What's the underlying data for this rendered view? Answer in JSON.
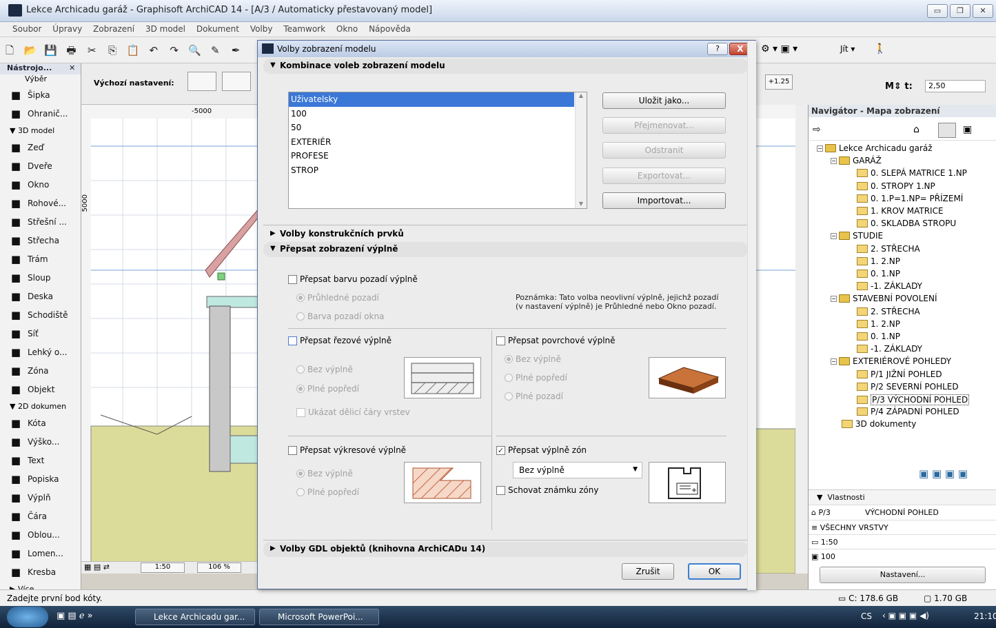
{
  "window": {
    "title": "Lekce Archicadu garáž - Graphisoft ArchiCAD 14 - [A/3 / Automaticky přestavovaný model]"
  },
  "menu": [
    "Soubor",
    "Úpravy",
    "Zobrazení",
    "3D model",
    "Dokument",
    "Volby",
    "Teamwork",
    "Okno",
    "Nápověda"
  ],
  "toolbox": {
    "title": "Nástrojo...",
    "select_label": "Výběr",
    "tools_a": [
      {
        "icon": "arrow-icon",
        "label": "Šipka"
      },
      {
        "icon": "marquee-icon",
        "label": "Ohranič..."
      }
    ],
    "section_3d": "3D model",
    "tools_3d": [
      {
        "icon": "wall-icon",
        "label": "Zeď"
      },
      {
        "icon": "door-icon",
        "label": "Dveře"
      },
      {
        "icon": "window-icon",
        "label": "Okno"
      },
      {
        "icon": "corner-window-icon",
        "label": "Rohové..."
      },
      {
        "icon": "roof-window-icon",
        "label": "Střešní ..."
      },
      {
        "icon": "roof-icon",
        "label": "Střecha"
      },
      {
        "icon": "beam-icon",
        "label": "Trám"
      },
      {
        "icon": "column-icon",
        "label": "Sloup"
      },
      {
        "icon": "slab-icon",
        "label": "Deska"
      },
      {
        "icon": "stair-icon",
        "label": "Schodiště"
      },
      {
        "icon": "mesh-icon",
        "label": "Síť"
      },
      {
        "icon": "curtain-wall-icon",
        "label": "Lehký o..."
      },
      {
        "icon": "zone-icon",
        "label": "Zóna"
      },
      {
        "icon": "object-icon",
        "label": "Objekt"
      }
    ],
    "section_2d": "2D dokumen",
    "tools_2d": [
      {
        "icon": "dimension-icon",
        "label": "Kóta"
      },
      {
        "icon": "level-icon",
        "label": "Výško..."
      },
      {
        "icon": "text-icon",
        "label": "Text"
      },
      {
        "icon": "label-icon",
        "label": "Popiska"
      },
      {
        "icon": "fill-icon",
        "label": "Výplň"
      },
      {
        "icon": "line-icon",
        "label": "Čára"
      },
      {
        "icon": "arc-icon",
        "label": "Oblou..."
      },
      {
        "icon": "polyline-icon",
        "label": "Lomen..."
      },
      {
        "icon": "drawing-icon",
        "label": "Kresba"
      }
    ],
    "more": "Více"
  },
  "infobox": {
    "default_label": "Výchozí nastavení:",
    "scale_btn": "+1.25",
    "value": "2,50"
  },
  "canvas": {
    "ruler": "-5000",
    "vruler": "5000",
    "scale": "1:50",
    "zoom": "106 %"
  },
  "status": {
    "prompt": "Zadejte první bod kóty.",
    "disk": "C: 178.6 GB",
    "ram": "1.70 GB"
  },
  "taskbar": {
    "tasks": [
      "Lekce Archicadu gar...",
      "Microsoft PowerPoi..."
    ],
    "lang": "CS",
    "time": "21:10"
  },
  "navigator": {
    "title": "Navigátor - Mapa zobrazení",
    "project": "Lekce Archicadu garáž",
    "groups": [
      {
        "name": "GARÁŽ",
        "items": [
          "0. SLEPÁ MATRICE 1.NP",
          "0. STROPY 1.NP",
          "0. 1.P=1.NP= PŘÍZEMÍ",
          "1. KROV MATRICE",
          "0. SKLADBA STROPU"
        ]
      },
      {
        "name": "STUDIE",
        "items": [
          "2. STŘECHA",
          "1. 2.NP",
          "0. 1.NP",
          "-1. ZÁKLADY"
        ]
      },
      {
        "name": "STAVEBNÍ POVOLENÍ",
        "items": [
          "2. STŘECHA",
          "1. 2.NP",
          "0. 1.NP",
          "-1. ZÁKLADY"
        ]
      },
      {
        "name": "EXTERIÉROVÉ POHLEDY",
        "items": [
          "P/1 JIŽNÍ POHLED",
          "P/2 SEVERNÍ POHLED",
          "P/3 VÝCHODNÍ POHLED",
          "P/4 ZÁPADNÍ POHLED"
        ]
      }
    ],
    "docs": "3D dokumenty",
    "props_title": "Vlastnosti",
    "prop_id": "P/3",
    "prop_name": "VÝCHODNÍ POHLED",
    "prop_layers": "VŠECHNY VRSTVY",
    "prop_scale": "1:50",
    "prop_zoom": "100",
    "settings_btn": "Nastavení..."
  },
  "dialog": {
    "title": "Volby zobrazení modelu",
    "help": "?",
    "close": "X",
    "sec1": "Kombinace voleb zobrazení modelu",
    "combos": [
      "Uživatelsky",
      "100",
      "50",
      "EXTERIÉR",
      "PROFESE",
      "STROP"
    ],
    "btn_save": "Uložit jako...",
    "btn_rename": "Přejmenovat...",
    "btn_delete": "Odstranit",
    "btn_export": "Exportovat...",
    "btn_import": "Importovat...",
    "sec2": "Volby konstrukčních prvků",
    "sec3": "Přepsat zobrazení výplně",
    "bg_override": "Přepsat barvu pozadí výplně",
    "bg_transparent": "Průhledné pozadí",
    "bg_window": "Barva pozadí okna",
    "note": "Poznámka: Tato volba neovlivní výplně, jejichž pozadí (v nastavení výplně) je Průhledné nebo Okno pozadí.",
    "cut_override": "Přepsat řezové výplně",
    "cut_none": "Bez výplně",
    "cut_solid": "Plné popředí",
    "cut_lines": "Ukázat dělicí čáry vrstev",
    "surf_override": "Přepsat povrchové výplně",
    "surf_none": "Bez výplně",
    "surf_fore": "Plné popředí",
    "surf_back": "Plné pozadí",
    "draft_override": "Přepsat výkresové výplně",
    "draft_none": "Bez výplně",
    "draft_solid": "Plné popředí",
    "zone_override": "Přepsat výplně zón",
    "zone_value": "Bez výplně",
    "zone_hide": "Schovat známku zóny",
    "sec4": "Volby GDL objektů (knihovna ArchiCADu 14)",
    "cancel": "Zrušit",
    "ok": "OK"
  }
}
